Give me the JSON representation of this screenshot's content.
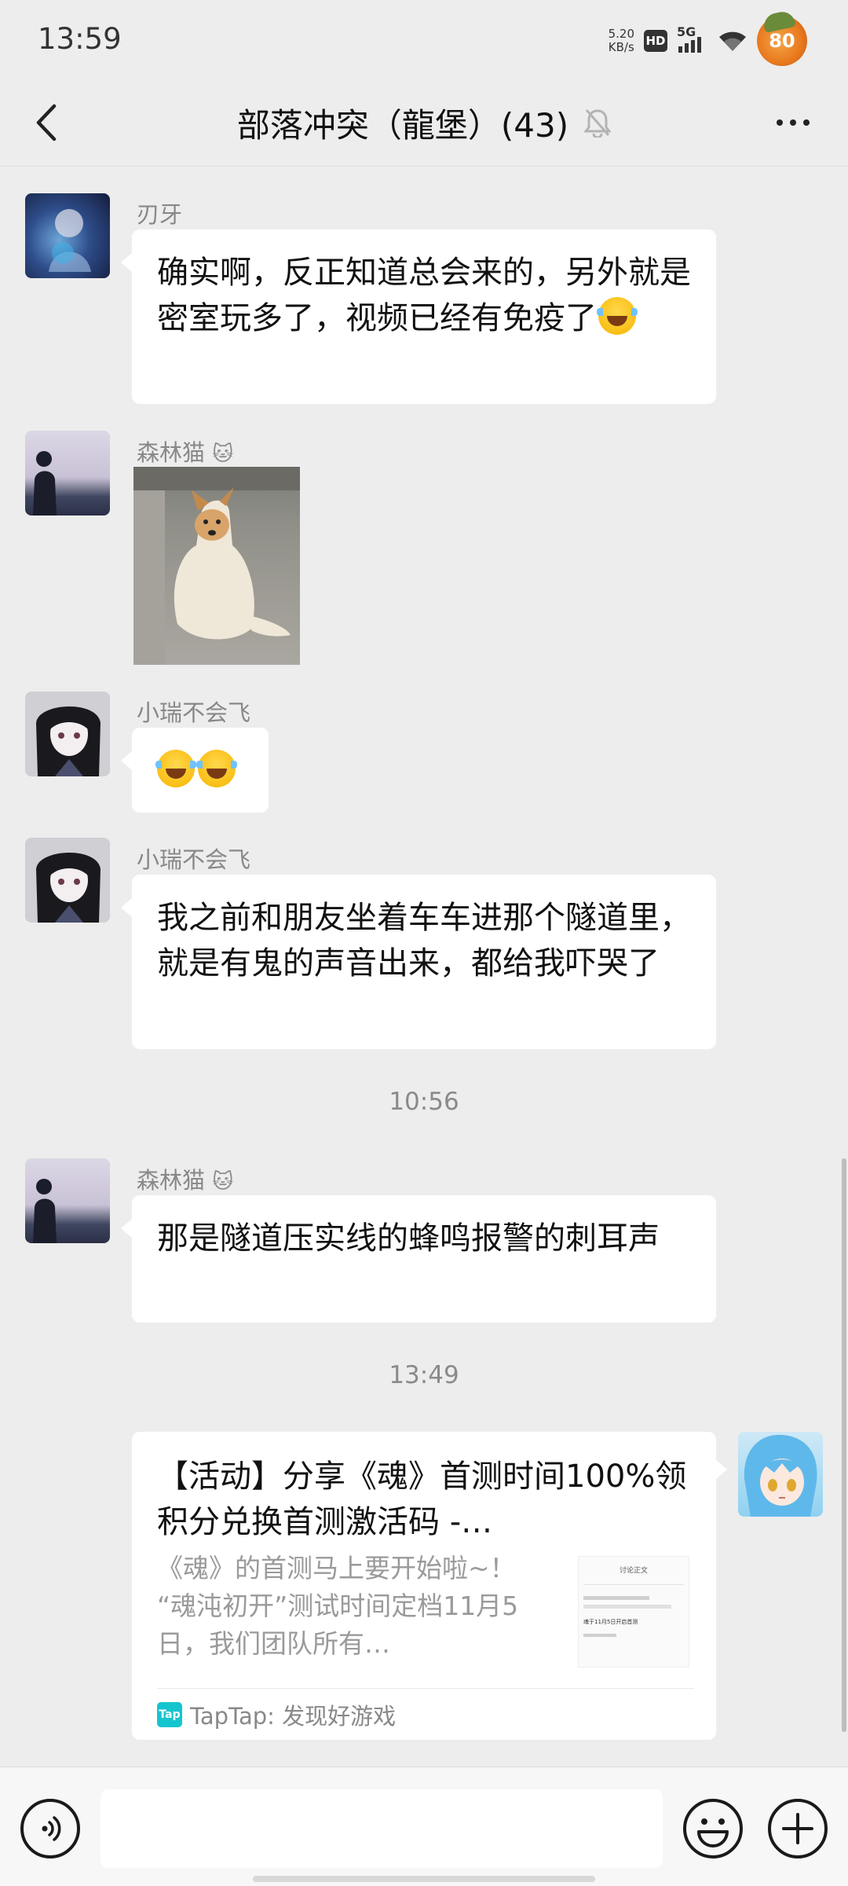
{
  "status_bar": {
    "time": "13:59",
    "net_speed_value": "5.20",
    "net_speed_unit": "KB/s",
    "hd_label": "HD",
    "network_label": "5G",
    "battery_level": "80"
  },
  "header": {
    "title": "部落冲突（龍堡）(43)",
    "mute_icon": "bell-off-icon",
    "back_icon": "chevron-left-icon",
    "more_icon": "more-dots-icon"
  },
  "messages": [
    {
      "sender": "刃牙",
      "text_before_emoji": "确实啊，反正知道总会来的，另外就是密室玩多了，视频已经有免疫了",
      "emoji": "laugh-tears"
    },
    {
      "sender": "森林猫",
      "sender_badge_icon": "cat-emoji-icon",
      "image": "dog-photo"
    },
    {
      "sender": "小瑞不会飞",
      "emojis": [
        "laugh-tears",
        "laugh-tears"
      ]
    },
    {
      "sender": "小瑞不会飞",
      "text": "我之前和朋友坐着车车进那个隧道里，就是有鬼的声音出来，都给我吓哭了"
    },
    {
      "sender": "森林猫",
      "sender_badge_icon": "cat-emoji-icon",
      "text": "那是隧道压实线的蜂鸣报警的刺耳声"
    }
  ],
  "timestamps": [
    "10:56",
    "13:49"
  ],
  "link_card": {
    "title": "【活动】分享《魂》首测时间100%领积分兑换首测激活码 -…",
    "description": "《魂》的首测马上要开始啦~！ “魂沌初开”测试时间定档11月5日，我们团队所有…",
    "thumb_heading": "讨论正文",
    "thumb_caption": "魂于11月5日开启首测",
    "source_logo": "Tap",
    "source": "TapTap: 发现好游戏"
  },
  "input_bar": {
    "placeholder": "",
    "voice_icon": "voice-icon",
    "emoji_icon": "smiley-icon",
    "plus_icon": "plus-icon"
  }
}
